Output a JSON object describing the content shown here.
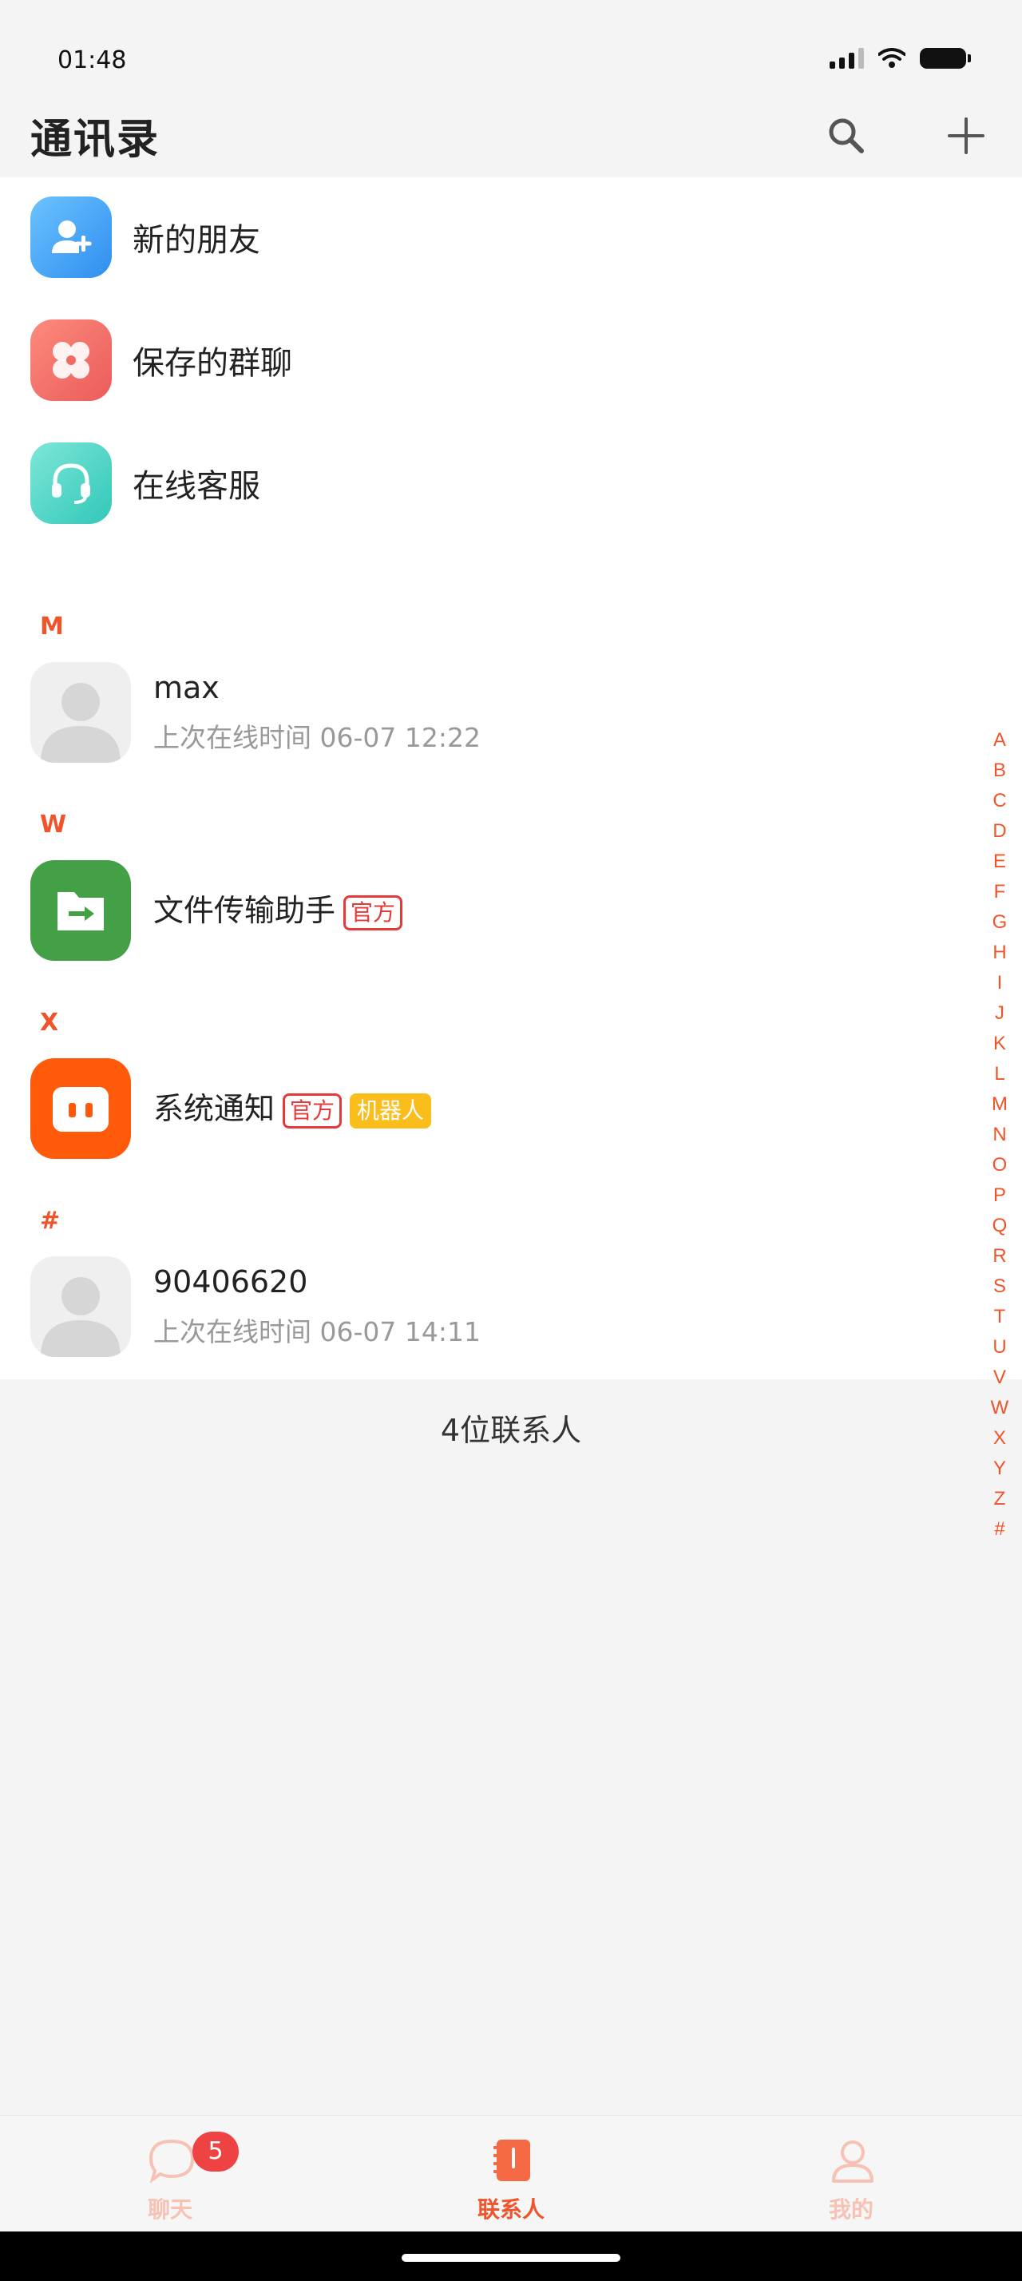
{
  "status_bar": {
    "time": "01:48"
  },
  "header": {
    "title": "通讯录"
  },
  "menu": [
    {
      "label": "新的朋友",
      "color": "#3f9ff7"
    },
    {
      "label": "保存的群聊",
      "color": "#f16a63"
    },
    {
      "label": "在线客服",
      "color": "#3fd1c2"
    }
  ],
  "sections": [
    {
      "letter": "M",
      "contact": {
        "name": "max",
        "subtitle": "上次在线时间 06-07 12:22"
      }
    },
    {
      "letter": "W",
      "contact": {
        "name": "文件传输助手",
        "tags": [
          "官方"
        ]
      }
    },
    {
      "letter": "X",
      "contact": {
        "name": "系统通知",
        "tags": [
          "官方",
          "机器人"
        ]
      }
    },
    {
      "letter": "#",
      "contact": {
        "name": "90406620",
        "subtitle": "上次在线时间 06-07 14:11"
      }
    }
  ],
  "summary": "4位联系人",
  "index_letters": [
    "A",
    "B",
    "C",
    "D",
    "E",
    "F",
    "G",
    "H",
    "I",
    "J",
    "K",
    "L",
    "M",
    "N",
    "O",
    "P",
    "Q",
    "R",
    "S",
    "T",
    "U",
    "V",
    "W",
    "X",
    "Y",
    "Z",
    "#"
  ],
  "bottom_nav": {
    "tabs": [
      {
        "label": "聊天",
        "badge": "5"
      },
      {
        "label": "联系人"
      },
      {
        "label": "我的"
      }
    ]
  },
  "colors": {
    "accent": "#f0542a",
    "inactive_tab": "#f7c2b4"
  }
}
